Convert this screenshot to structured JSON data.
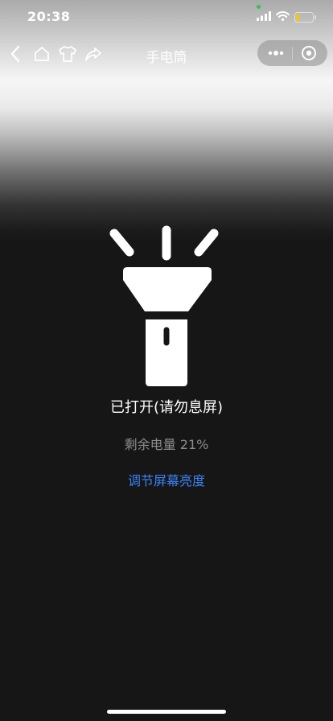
{
  "status_bar": {
    "time": "20:38",
    "battery_color": "#f5c518"
  },
  "nav": {
    "title": "手电筒"
  },
  "main": {
    "status_text": "已打开(请勿息屏)",
    "battery_text": "剩余电量 21%",
    "battery_level_percent": 21,
    "brightness_link": "调节屏幕亮度"
  },
  "colors": {
    "accent": "#3b82f6",
    "background": "#161616",
    "secondary_text": "#8d8d8d"
  }
}
